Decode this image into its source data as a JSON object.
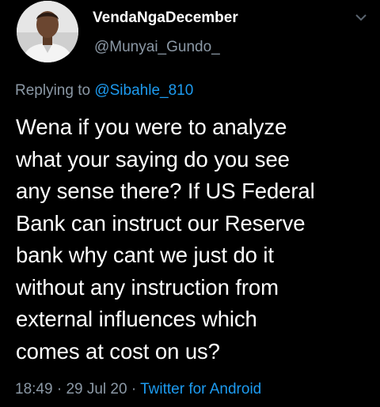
{
  "user": {
    "display_name": "VendaNgaDecember",
    "handle": "@Munyai_Gundo_"
  },
  "reply": {
    "prefix": "Replying to ",
    "mention": "@Sibahle_810"
  },
  "tweet": {
    "lines": [
      "Wena if you were to analyze",
      "what your saying do you see",
      "any sense there? If US Federal",
      "Bank can instruct our Reserve",
      "bank why cant we just do it",
      "without any instruction from",
      "external influences which",
      "comes at cost on us?"
    ]
  },
  "meta": {
    "time": "18:49",
    "sep1": " · ",
    "date": "29 Jul 20",
    "sep2": " · ",
    "source": "Twitter for Android"
  },
  "icons": {
    "menu": "chevron-down-icon",
    "avatar": "profile-photo"
  },
  "colors": {
    "background": "#000000",
    "text": "#ffffff",
    "muted": "#8b98a5",
    "link": "#1d9bf0"
  }
}
